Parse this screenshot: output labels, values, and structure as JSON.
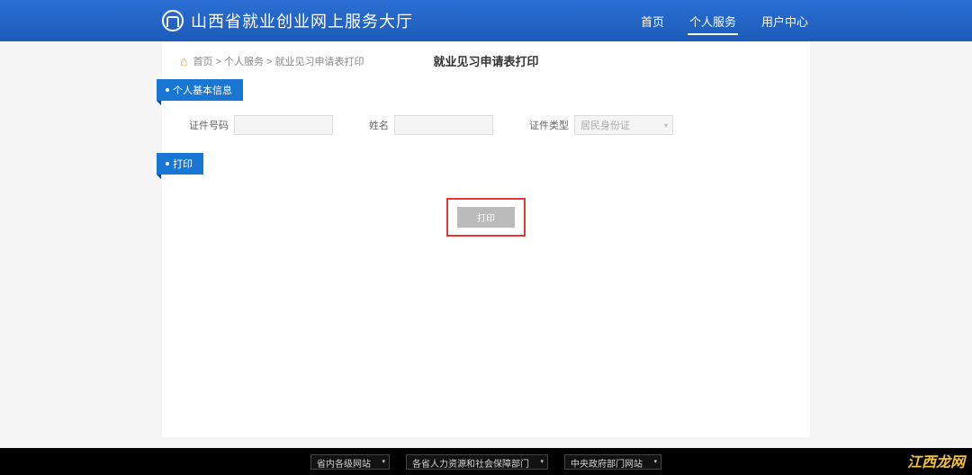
{
  "header": {
    "site_title": "山西省就业创业网上服务大厅",
    "nav": [
      {
        "label": "首页",
        "active": false
      },
      {
        "label": "个人服务",
        "active": true
      },
      {
        "label": "用户中心",
        "active": false
      }
    ]
  },
  "breadcrumb": {
    "text": "首页 > 个人服务 > 就业见习申请表打印"
  },
  "page_title": "就业见习申请表打印",
  "sections": {
    "basic_info": {
      "title": "个人基本信息",
      "fields": {
        "id_number": {
          "label": "证件号码",
          "value": ""
        },
        "name": {
          "label": "姓名",
          "value": ""
        },
        "id_type": {
          "label": "证件类型",
          "value": "居民身份证"
        }
      }
    },
    "print": {
      "title": "打印",
      "button_label": "打印"
    }
  },
  "footer": {
    "selects": [
      {
        "label": "省内各级网站"
      },
      {
        "label": "各省人力资源和社会保障部门"
      },
      {
        "label": "中央政府部门网站"
      }
    ]
  },
  "watermark": "江西龙网"
}
